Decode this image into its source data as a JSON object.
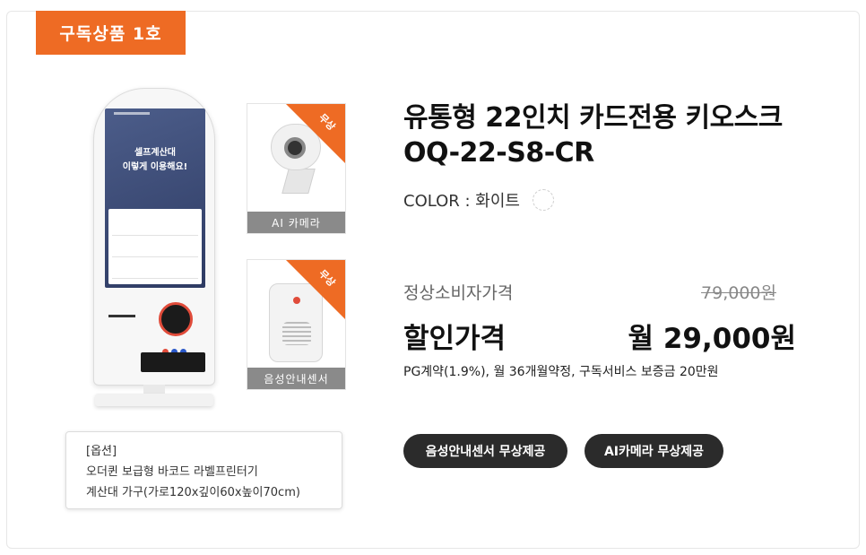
{
  "badge": "구독상품 1호",
  "kiosk_screen": {
    "headline_1": "셀프계산대",
    "headline_2": "이렇게 이용해요!"
  },
  "free_items": [
    {
      "ribbon": "무상",
      "label": "AI 카메라",
      "icon": "webcam-icon"
    },
    {
      "ribbon": "무상",
      "label": "음성안내센서",
      "icon": "speaker-sensor-icon"
    }
  ],
  "options": {
    "heading": "[옵션]",
    "line1": "오더퀸 보급형 바코드 라벨프린터기",
    "line2": "계산대 가구(가로120x깊이60x높이70cm)"
  },
  "product": {
    "title_line1": "유통형 22인치 카드전용 키오스크",
    "title_line2": "OQ-22-S8-CR",
    "color_label": "COLOR : 화이트",
    "color_swatch": "#ffffff"
  },
  "pricing": {
    "msrp_label": "정상소비자가격",
    "msrp_value": "79,000원",
    "sale_label": "할인가격",
    "sale_value": "월 29,000원",
    "terms": "PG계약(1.9%), 월 36개월약정, 구독서비스 보증금 20만원"
  },
  "buttons": {
    "voice_sensor": "음성안내센서 무상제공",
    "ai_camera": "AI카메라 무상제공"
  },
  "colors": {
    "accent": "#ee6b24",
    "button_bg": "#2b2b2b",
    "label_bg": "#8a8a8a"
  }
}
